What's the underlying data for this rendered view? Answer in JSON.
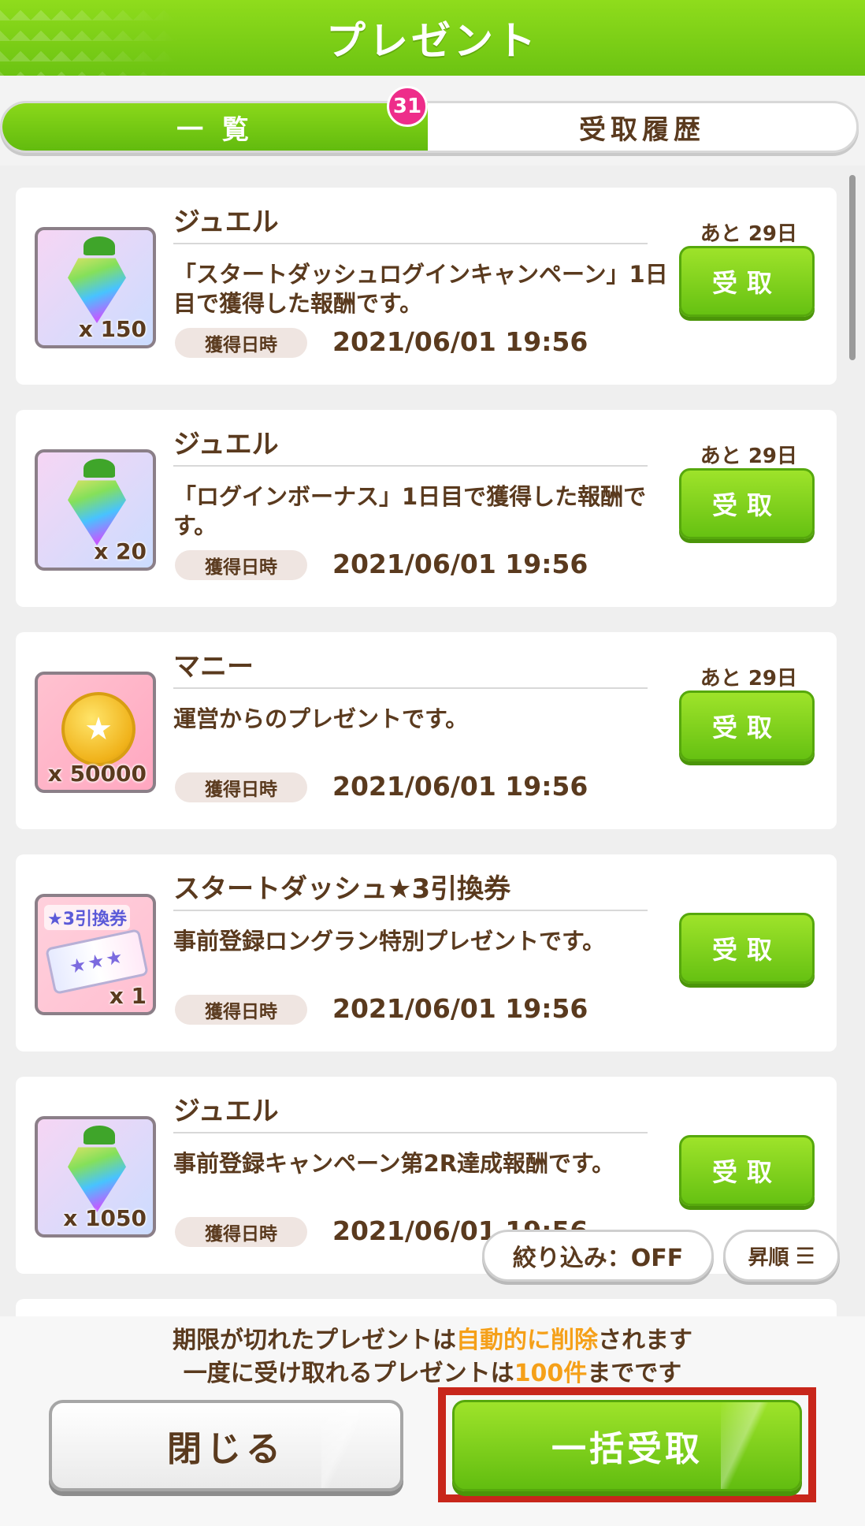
{
  "header": {
    "title": "プレゼント"
  },
  "tabs": [
    {
      "label": "一 覧",
      "badge": "31"
    },
    {
      "label": "受取履歴"
    }
  ],
  "items": [
    {
      "name": "ジュエル",
      "quantity": "x 150",
      "description": "「スタートダッシュログインキャンペーン」1日目で獲得した報酬です。",
      "date_label": "獲得日時",
      "date": "2021/06/01 19:56",
      "remaining": "あと 29日",
      "button": "受取",
      "icon": "jewel-icon"
    },
    {
      "name": "ジュエル",
      "quantity": "x 20",
      "description": "「ログインボーナス」1日目で獲得した報酬です。",
      "date_label": "獲得日時",
      "date": "2021/06/01 19:56",
      "remaining": "あと 29日",
      "button": "受取",
      "icon": "jewel-icon"
    },
    {
      "name": "マニー",
      "quantity": "x 50000",
      "description": "運営からのプレゼントです。",
      "date_label": "獲得日時",
      "date": "2021/06/01 19:56",
      "remaining": "あと 29日",
      "button": "受取",
      "icon": "coin-icon"
    },
    {
      "name": "スタートダッシュ★3引換券",
      "quantity": "x 1",
      "description": "事前登録ロングラン特別プレゼントです。",
      "ticket_label": "★3引換券",
      "date_label": "獲得日時",
      "date": "2021/06/01 19:56",
      "remaining": "",
      "button": "受取",
      "icon": "ticket-icon"
    },
    {
      "name": "ジュエル",
      "quantity": "x 1050",
      "description": "事前登録キャンペーン第2R達成報酬です。",
      "date_label": "獲得日時",
      "date": "2021/06/01 19:56",
      "remaining": "",
      "button": "受取",
      "icon": "jewel-icon"
    }
  ],
  "filter": {
    "label": "絞り込み：OFF"
  },
  "sort": {
    "label": "昇順",
    "icon": "sort-lines-icon"
  },
  "notice": {
    "line1_a": "期限が切れたプレゼントは",
    "line1_hl": "自動的に削除",
    "line1_b": "されます",
    "line2_a": "一度に受け取れるプレゼントは",
    "line2_hl": "100件",
    "line2_b": "までです"
  },
  "footer": {
    "close_label": "閉じる",
    "bulk_label": "一括受取"
  },
  "colors": {
    "accent_green": "#6cc312",
    "highlight_orange": "#f5a019",
    "badge_pink": "#ee2d8a",
    "frame_red": "#c8261b"
  }
}
